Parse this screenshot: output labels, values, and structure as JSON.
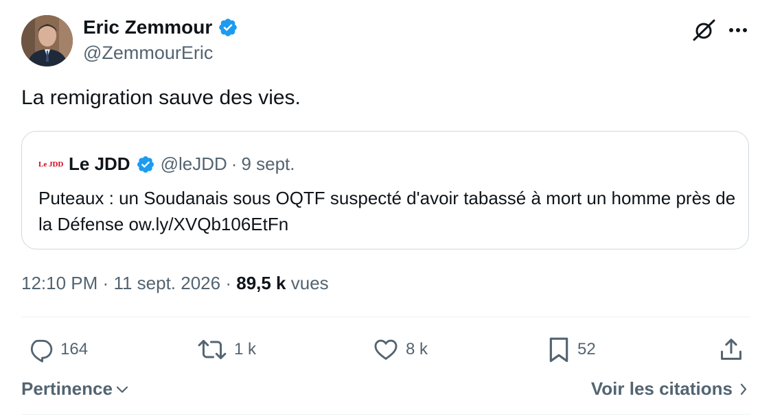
{
  "author": {
    "name": "Eric Zemmour",
    "handle": "@ZemmourEric",
    "verified": true
  },
  "tweet": {
    "text": "La remigration sauve des vies."
  },
  "quoted": {
    "logo": "Le JDD",
    "name": "Le JDD",
    "handle": "@leJDD",
    "separator": "·",
    "date": "9 sept.",
    "text": "Puteaux : un Soudanais sous OQTF suspecté d'avoir tabassé à mort un homme près de la Défense ow.ly/XVQb106EtFn"
  },
  "meta": {
    "time": "12:10 PM",
    "sep1": "·",
    "date": "11 sept. 2026",
    "sep2": "·",
    "views_count": "89,5 k",
    "views_label": "vues"
  },
  "actions": {
    "replies": "164",
    "reposts": "1 k",
    "likes": "8 k",
    "bookmarks": "52"
  },
  "footer": {
    "sort_label": "Pertinence",
    "quotes_label": "Voir les citations"
  },
  "colors": {
    "verified": "#1d9bf0",
    "secondary_text": "#536471",
    "primary_text": "#0f1419",
    "border": "#cfd9de"
  },
  "icons": [
    "verified-badge-icon",
    "grok-icon",
    "more-icon",
    "reply-icon",
    "repost-icon",
    "like-icon",
    "bookmark-icon",
    "share-icon",
    "chevron-down-icon",
    "chevron-right-icon"
  ]
}
